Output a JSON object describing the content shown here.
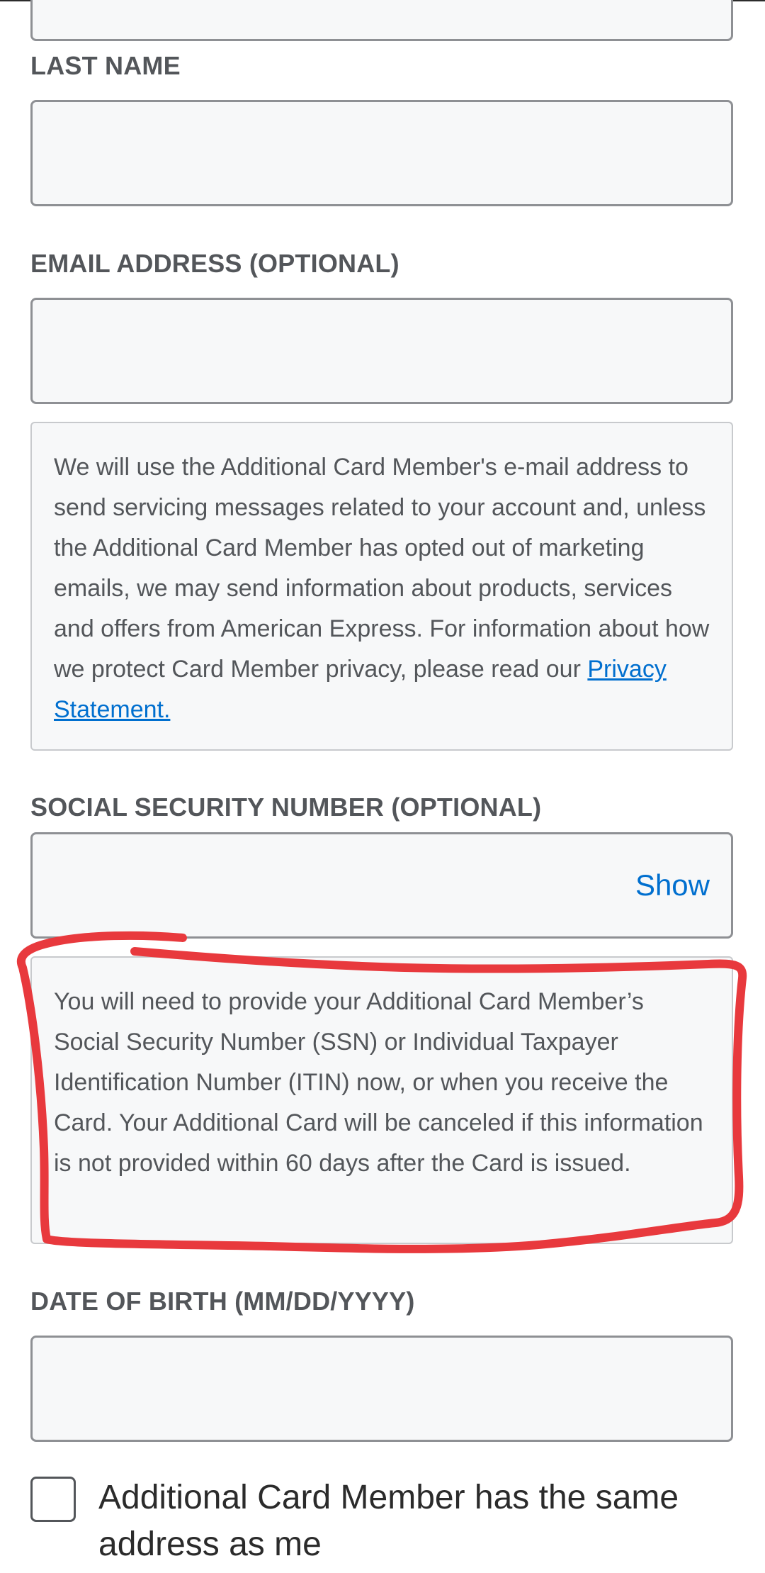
{
  "form": {
    "first_name_value": "",
    "last_name_label": "LAST NAME",
    "last_name_value": "",
    "email_label": "EMAIL ADDRESS (OPTIONAL)",
    "email_value": "",
    "email_notice": {
      "text": "We will use the Additional Card Member's e-mail address to send servicing messages related to your account and, unless the Additional Card Member has opted out of marketing emails, we may send information about products, services and offers from American Express. For information about how we protect Card Member privacy, please read our ",
      "link_text": "Privacy Statement."
    },
    "ssn_label": "SOCIAL SECURITY NUMBER (OPTIONAL)",
    "ssn_value": "",
    "ssn_show_label": "Show",
    "ssn_notice": "You will need to provide your Additional Card Member’s Social Security Number (SSN) or Individual Taxpayer Identification Number (ITIN) now, or when you receive the Card. Your Additional Card will be canceled if this information is not provided within 60 days after the Card is issued.",
    "dob_label": "DATE OF BIRTH (MM/DD/YYYY)",
    "dob_value": "",
    "same_address_label": "Additional Card Member has the same address as me",
    "same_address_checked": false
  },
  "colors": {
    "link": "#006fcf",
    "text": "#53565a",
    "field_bg": "#f7f8f9",
    "field_border": "#8e9094",
    "annotation": "#e8393d"
  },
  "annotation": {
    "shape": "hand-drawn red outline around SSN notice"
  }
}
